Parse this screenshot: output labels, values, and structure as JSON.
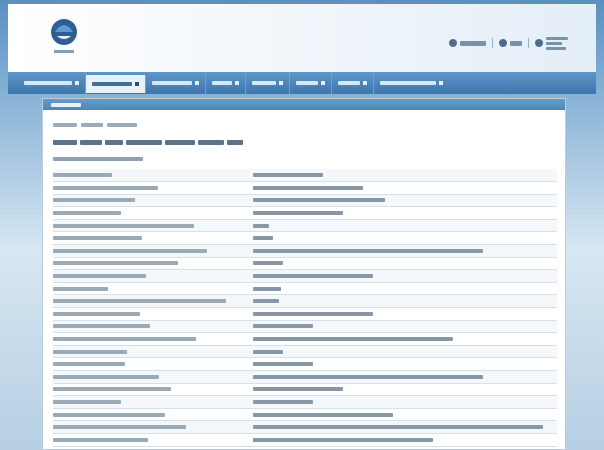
{
  "header": {
    "logo": {
      "name": "site-logo"
    },
    "links": [
      {
        "label": "",
        "icon": "user-icon"
      },
      {
        "label": "",
        "icon": "info-icon"
      },
      {
        "label": "",
        "icon": "help-icon"
      }
    ]
  },
  "nav": {
    "items": [
      {
        "label": ""
      },
      {
        "label": ""
      },
      {
        "label": ""
      },
      {
        "label": ""
      },
      {
        "label": ""
      },
      {
        "label": ""
      },
      {
        "label": ""
      },
      {
        "label": ""
      }
    ]
  },
  "content": {
    "header_label": "",
    "breadcrumb": "",
    "title": "",
    "section_label": "",
    "rows": [
      {
        "key": "",
        "value": ""
      },
      {
        "key": "",
        "value": ""
      },
      {
        "key": "",
        "value": ""
      },
      {
        "key": "",
        "value": ""
      },
      {
        "key": "",
        "value": ""
      },
      {
        "key": "",
        "value": ""
      },
      {
        "key": "",
        "value": ""
      },
      {
        "key": "",
        "value": ""
      },
      {
        "key": "",
        "value": ""
      },
      {
        "key": "",
        "value": ""
      },
      {
        "key": "",
        "value": ""
      },
      {
        "key": "",
        "value": ""
      },
      {
        "key": "",
        "value": ""
      },
      {
        "key": "",
        "value": ""
      },
      {
        "key": "",
        "value": ""
      },
      {
        "key": "",
        "value": ""
      },
      {
        "key": "",
        "value": ""
      },
      {
        "key": "",
        "value": ""
      },
      {
        "key": "",
        "value": ""
      },
      {
        "key": "",
        "value": ""
      },
      {
        "key": "",
        "value": ""
      },
      {
        "key": "",
        "value": ""
      }
    ]
  },
  "colors": {
    "page_background": "#3b73a6",
    "nav_background": "#4b86bb",
    "nav_active": "#e9f1f8",
    "content_header": "#5a8fc0",
    "table_stripe": "#f4f8fb"
  }
}
